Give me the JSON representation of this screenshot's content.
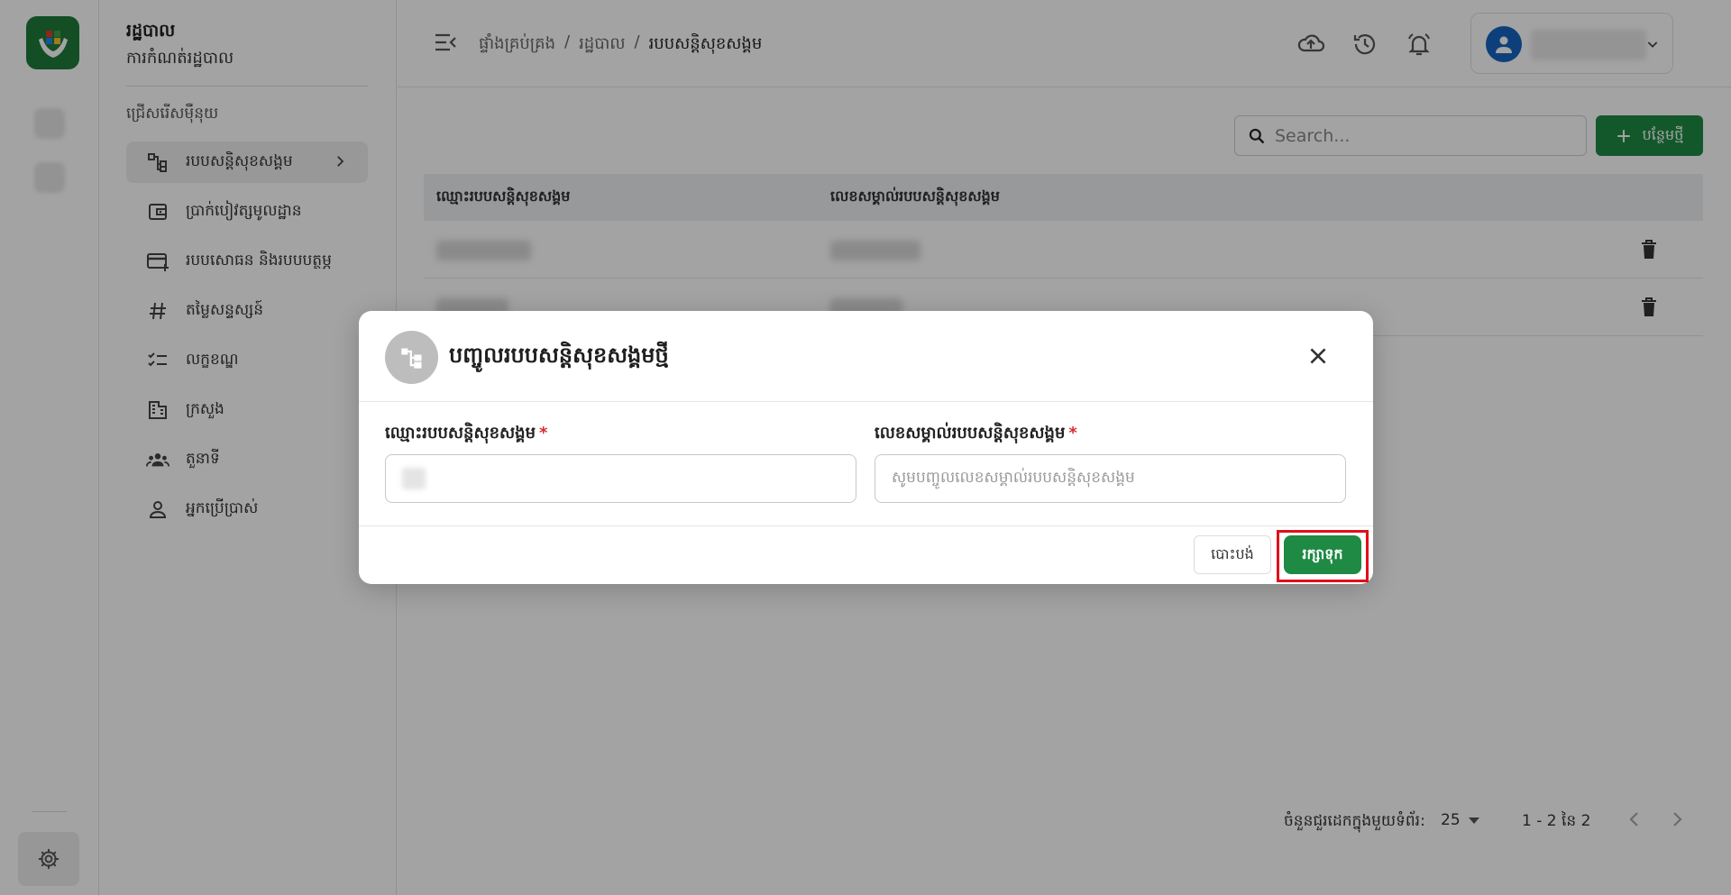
{
  "sidebar": {
    "title": "រដ្ឋបាល",
    "subtitle": "ការកំណត់រដ្ឋបាល",
    "section": "ជ្រើសរើសម៉ឺនុយ",
    "items": [
      {
        "label": "របបសន្តិសុខសង្គម",
        "icon": "hierarchy-icon"
      },
      {
        "label": "ប្រាក់បៀវត្សមូលដ្ឋាន",
        "icon": "wallet-icon"
      },
      {
        "label": "របបសោធន និងរបបបត្ថម្ភ",
        "icon": "card-plus-icon"
      },
      {
        "label": "តម្លៃសន្ទស្សន៍",
        "icon": "hash-icon"
      },
      {
        "label": "លក្ខខណ្ឌ",
        "icon": "checklist-icon"
      },
      {
        "label": "ក្រសួង",
        "icon": "building-icon"
      },
      {
        "label": "តួនាទី",
        "icon": "group-icon"
      },
      {
        "label": "អ្នកប្រើប្រាស់",
        "icon": "user-icon"
      }
    ]
  },
  "header": {
    "breadcrumb": [
      "ផ្ទាំងគ្រប់គ្រង",
      "/",
      "រដ្ឋបាល",
      "/",
      "របបសន្តិសុខសង្គម"
    ]
  },
  "main": {
    "search_placeholder": "Search...",
    "add_label": "បន្ថែមថ្មី",
    "columns": [
      "ឈ្មោះរបបសន្តិសុខសង្គម",
      "លេខសម្គាល់របបសន្តិសុខសង្គម"
    ],
    "rows_per_page_label": "ចំនួនជួរដេកក្នុងមួយទំព័រ:",
    "rows_per_page": "25",
    "range": "1 - 2 នៃ 2"
  },
  "modal": {
    "title": "បញ្ចូលរបបសន្តិសុខសង្គមថ្មី",
    "field1_label": "ឈ្មោះរបបសន្តិសុខសង្គម",
    "field2_label": "លេខសម្គាល់របបសន្តិសុខសង្គម",
    "required_mark": "*",
    "field2_placeholder": "សូមបញ្ចូលលេខសម្គាល់របបសន្តិសុខសង្គម",
    "cancel_label": "បោះបង់",
    "save_label": "រក្សាទុក"
  },
  "colors": {
    "brand_green": "#1e8a44",
    "avatar_blue": "#1565c0",
    "highlight_red": "#e0101a"
  }
}
